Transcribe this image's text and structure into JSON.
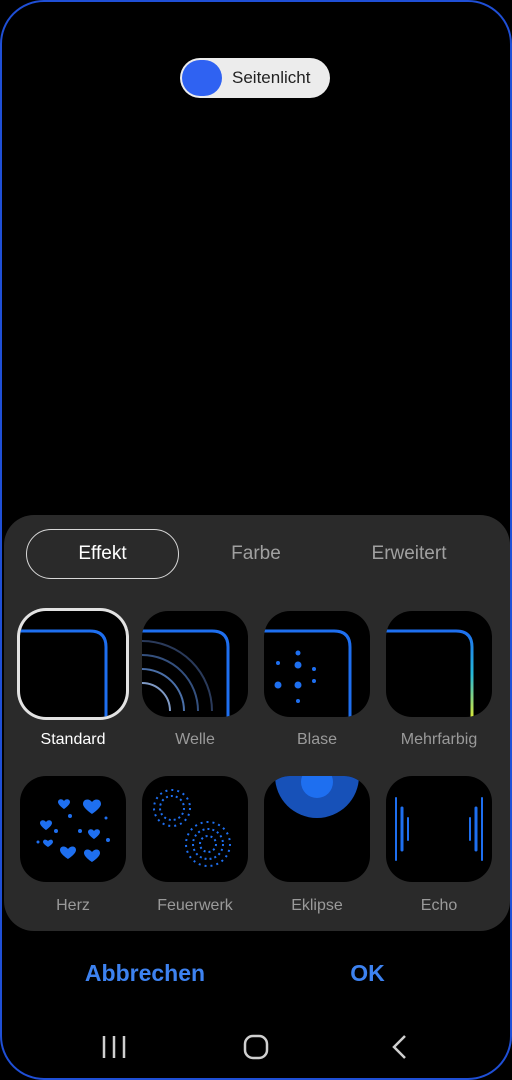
{
  "edge_toggle": {
    "label": "Seitenlicht",
    "on": true,
    "color": "#2f62f2"
  },
  "tabs": [
    {
      "label": "Effekt",
      "active": true
    },
    {
      "label": "Farbe",
      "active": false
    },
    {
      "label": "Erweitert",
      "active": false
    }
  ],
  "effects": [
    {
      "label": "Standard",
      "selected": true,
      "icon": "standard-effect-icon"
    },
    {
      "label": "Welle",
      "selected": false,
      "icon": "wave-effect-icon"
    },
    {
      "label": "Blase",
      "selected": false,
      "icon": "bubble-effect-icon"
    },
    {
      "label": "Mehrfarbig",
      "selected": false,
      "icon": "multicolor-effect-icon"
    },
    {
      "label": "Herz",
      "selected": false,
      "icon": "heart-effect-icon"
    },
    {
      "label": "Feuerwerk",
      "selected": false,
      "icon": "firework-effect-icon"
    },
    {
      "label": "Eklipse",
      "selected": false,
      "icon": "eclipse-effect-icon"
    },
    {
      "label": "Echo",
      "selected": false,
      "icon": "echo-effect-icon"
    }
  ],
  "actions": {
    "cancel": "Abbrechen",
    "ok": "OK"
  },
  "nav": {
    "recents": "recents-icon",
    "home": "home-icon",
    "back": "back-icon"
  },
  "colors": {
    "accent": "#3d82f0",
    "edge_blue": "#1e6ff0",
    "panel": "#2a2a2a"
  }
}
